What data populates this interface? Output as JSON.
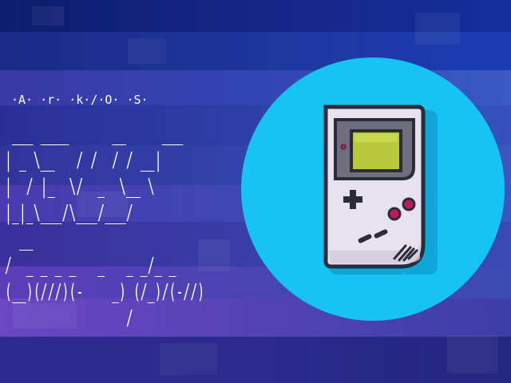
{
  "screen": {
    "subtitle": "·A· ·r· ·k·/·O· ·S·",
    "ascii_art": " ___ ____      __     ___\n| _ \\__   / /  / / __|\n|  / |_  \\/  _  \\__ \\\n|_|_\\___/\\___/___/\n  __\n/  _ _ _ _   _   _ _/_ _\n(__)(///)(-    _) (/_)/(-//)\n                 /",
    "logo_icon": "gameboy-icon",
    "colors": {
      "background_dark": "#16207a",
      "background_accent": "#5b3eb8",
      "circle": "#17c3f3",
      "device_body": "#e6e2ee",
      "device_outline": "#2b2b3a",
      "screen_frame": "#6e6e7e",
      "screen_green": "#b7c93a",
      "buttons": "#c0185c"
    }
  }
}
